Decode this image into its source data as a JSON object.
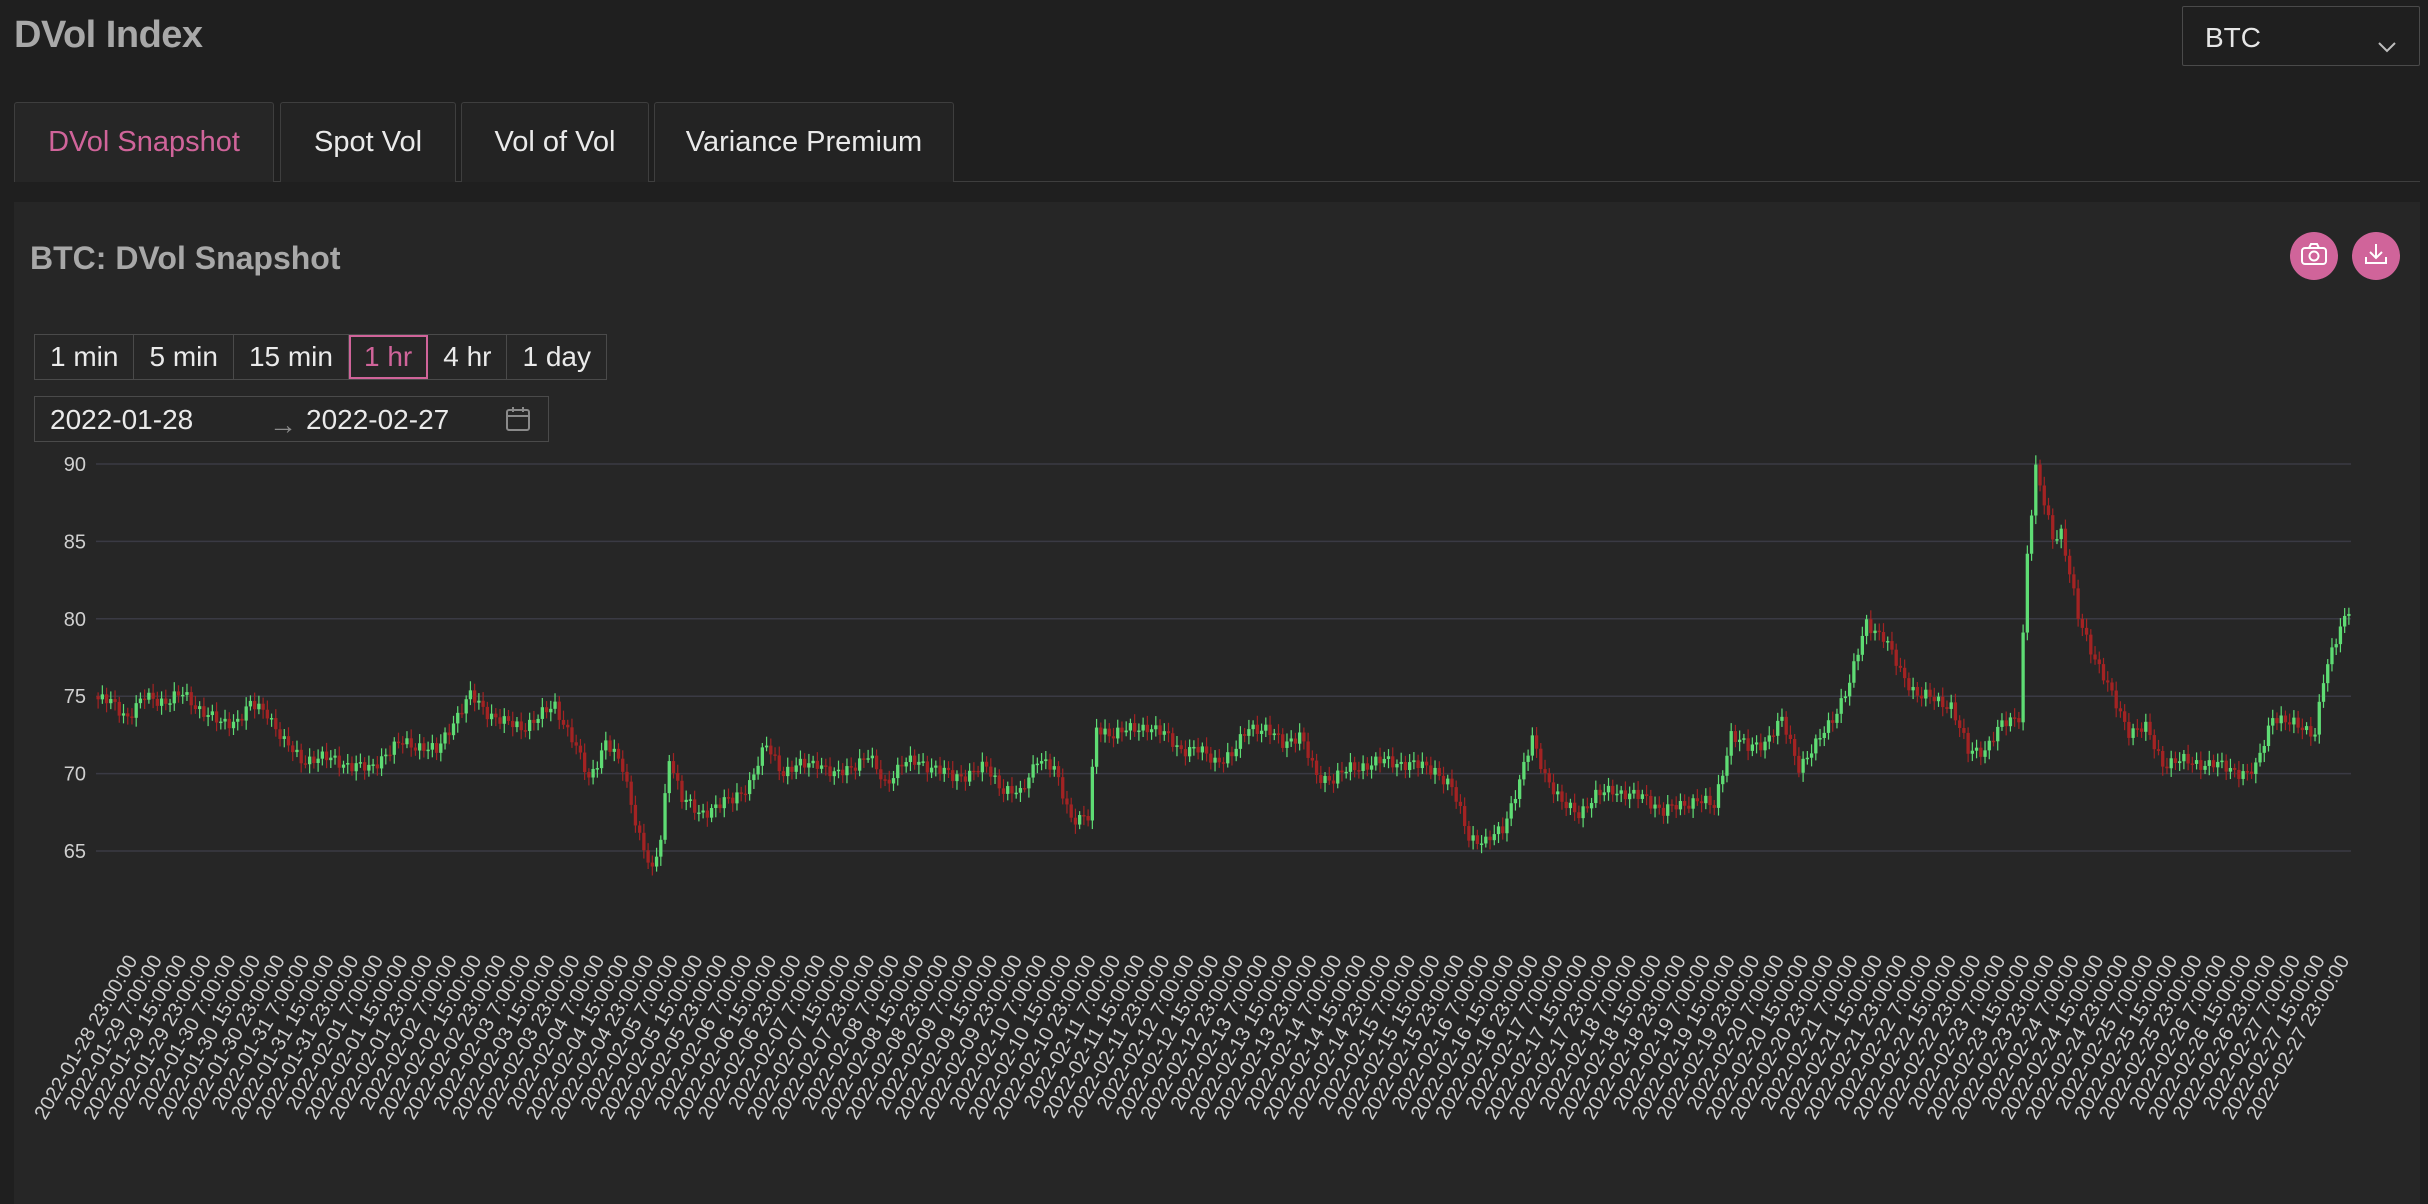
{
  "page": {
    "title": "DVol Index"
  },
  "asset_select": {
    "value": "BTC"
  },
  "tabs": [
    {
      "label": "DVol Snapshot",
      "active": true
    },
    {
      "label": "Spot Vol",
      "active": false
    },
    {
      "label": "Vol of Vol",
      "active": false
    },
    {
      "label": "Variance Premium",
      "active": false
    }
  ],
  "panel": {
    "title": "BTC: DVol Snapshot"
  },
  "icons": {
    "screenshot": "camera-icon",
    "download": "download-icon",
    "calendar": "calendar-icon",
    "dropdown": "chevron-down-icon"
  },
  "colors": {
    "accent": "#d0649a",
    "up": "#5fdc74",
    "down": "#a32323"
  },
  "intervals": [
    {
      "label": "1 min",
      "active": false
    },
    {
      "label": "5 min",
      "active": false
    },
    {
      "label": "15 min",
      "active": false
    },
    {
      "label": "1 hr",
      "active": true
    },
    {
      "label": "4 hr",
      "active": false
    },
    {
      "label": "1 day",
      "active": false
    }
  ],
  "date_range": {
    "start": "2022-01-28",
    "separator": "→",
    "end": "2022-02-27"
  },
  "chart_data": {
    "type": "candlestick",
    "title": "",
    "xlabel": "",
    "ylabel": "",
    "y_ticks": [
      90,
      85,
      80,
      75,
      70,
      65
    ],
    "ylim": [
      63,
      90
    ],
    "x_tick_labels": [
      "2022-01-28 23:00:00",
      "2022-01-29 7:00:00",
      "2022-01-29 15:00:00",
      "2022-01-29 23:00:00",
      "2022-01-30 7:00:00",
      "2022-01-30 15:00:00",
      "2022-01-30 23:00:00",
      "2022-01-31 7:00:00",
      "2022-01-31 15:00:00",
      "2022-01-31 23:00:00",
      "2022-02-01 7:00:00",
      "2022-02-01 15:00:00",
      "2022-02-01 23:00:00",
      "2022-02-02 7:00:00",
      "2022-02-02 15:00:00",
      "2022-02-02 23:00:00",
      "2022-02-03 7:00:00",
      "2022-02-03 15:00:00",
      "2022-02-03 23:00:00",
      "2022-02-04 7:00:00",
      "2022-02-04 15:00:00",
      "2022-02-04 23:00:00",
      "2022-02-05 7:00:00",
      "2022-02-05 15:00:00",
      "2022-02-05 23:00:00",
      "2022-02-06 7:00:00",
      "2022-02-06 15:00:00",
      "2022-02-06 23:00:00",
      "2022-02-07 7:00:00",
      "2022-02-07 15:00:00",
      "2022-02-07 23:00:00",
      "2022-02-08 7:00:00",
      "2022-02-08 15:00:00",
      "2022-02-08 23:00:00",
      "2022-02-09 7:00:00",
      "2022-02-09 15:00:00",
      "2022-02-09 23:00:00",
      "2022-02-10 7:00:00",
      "2022-02-10 15:00:00",
      "2022-02-10 23:00:00",
      "2022-02-11 7:00:00",
      "2022-02-11 15:00:00",
      "2022-02-11 23:00:00",
      "2022-02-12 7:00:00",
      "2022-02-12 15:00:00",
      "2022-02-12 23:00:00",
      "2022-02-13 7:00:00",
      "2022-02-13 15:00:00",
      "2022-02-13 23:00:00",
      "2022-02-14 7:00:00",
      "2022-02-14 15:00:00",
      "2022-02-14 23:00:00",
      "2022-02-15 7:00:00",
      "2022-02-15 15:00:00",
      "2022-02-15 23:00:00",
      "2022-02-16 7:00:00",
      "2022-02-16 15:00:00",
      "2022-02-16 23:00:00",
      "2022-02-17 7:00:00",
      "2022-02-17 15:00:00",
      "2022-02-17 23:00:00",
      "2022-02-18 7:00:00",
      "2022-02-18 15:00:00",
      "2022-02-18 23:00:00",
      "2022-02-19 7:00:00",
      "2022-02-19 15:00:00",
      "2022-02-19 23:00:00",
      "2022-02-20 7:00:00",
      "2022-02-20 15:00:00",
      "2022-02-20 23:00:00",
      "2022-02-21 7:00:00",
      "2022-02-21 15:00:00",
      "2022-02-21 23:00:00",
      "2022-02-22 7:00:00",
      "2022-02-22 15:00:00",
      "2022-02-22 23:00:00",
      "2022-02-23 7:00:00",
      "2022-02-23 15:00:00",
      "2022-02-23 23:00:00",
      "2022-02-24 7:00:00",
      "2022-02-24 15:00:00",
      "2022-02-24 23:00:00",
      "2022-02-25 7:00:00",
      "2022-02-25 15:00:00",
      "2022-02-25 23:00:00",
      "2022-02-26 7:00:00",
      "2022-02-26 15:00:00",
      "2022-02-26 23:00:00",
      "2022-02-27 7:00:00",
      "2022-02-27 15:00:00",
      "2022-02-27 23:00:00"
    ],
    "close_path": [
      [
        0,
        74.8
      ],
      [
        3,
        74.6
      ],
      [
        7,
        73.7
      ],
      [
        11,
        74.9
      ],
      [
        16,
        74.7
      ],
      [
        20,
        75.1
      ],
      [
        25,
        74.0
      ],
      [
        29,
        73.2
      ],
      [
        33,
        73.5
      ],
      [
        36,
        74.4
      ],
      [
        40,
        74.0
      ],
      [
        44,
        72.0
      ],
      [
        48,
        70.9
      ],
      [
        52,
        71.0
      ],
      [
        56,
        70.9
      ],
      [
        60,
        70.5
      ],
      [
        64,
        70.3
      ],
      [
        68,
        71.3
      ],
      [
        72,
        72.0
      ],
      [
        76,
        71.8
      ],
      [
        80,
        71.4
      ],
      [
        84,
        73.4
      ],
      [
        88,
        75.0
      ],
      [
        92,
        74.0
      ],
      [
        96,
        73.3
      ],
      [
        100,
        73.0
      ],
      [
        104,
        73.6
      ],
      [
        108,
        74.4
      ],
      [
        112,
        72.3
      ],
      [
        116,
        69.6
      ],
      [
        120,
        72.1
      ],
      [
        124,
        70.3
      ],
      [
        128,
        66.0
      ],
      [
        131,
        63.5
      ],
      [
        133,
        65.8
      ],
      [
        135,
        71.2
      ],
      [
        138,
        68.4
      ],
      [
        142,
        67.4
      ],
      [
        146,
        67.9
      ],
      [
        150,
        68.3
      ],
      [
        154,
        69.4
      ],
      [
        158,
        71.8
      ],
      [
        162,
        70.1
      ],
      [
        166,
        70.5
      ],
      [
        170,
        70.8
      ],
      [
        174,
        69.8
      ],
      [
        178,
        70.5
      ],
      [
        182,
        71.1
      ],
      [
        186,
        69.4
      ],
      [
        190,
        70.6
      ],
      [
        194,
        70.8
      ],
      [
        198,
        70.3
      ],
      [
        202,
        69.8
      ],
      [
        206,
        70.0
      ],
      [
        210,
        70.4
      ],
      [
        214,
        69.0
      ],
      [
        218,
        68.6
      ],
      [
        222,
        71.1
      ],
      [
        226,
        70.2
      ],
      [
        230,
        67.2
      ],
      [
        234,
        67.1
      ],
      [
        236,
        72.9
      ],
      [
        240,
        72.6
      ],
      [
        244,
        72.8
      ],
      [
        248,
        73.1
      ],
      [
        252,
        72.5
      ],
      [
        256,
        71.6
      ],
      [
        260,
        71.5
      ],
      [
        264,
        70.9
      ],
      [
        268,
        71.1
      ],
      [
        272,
        73.1
      ],
      [
        276,
        72.8
      ],
      [
        280,
        72.0
      ],
      [
        284,
        72.5
      ],
      [
        288,
        69.8
      ],
      [
        292,
        69.7
      ],
      [
        296,
        70.3
      ],
      [
        300,
        70.6
      ],
      [
        304,
        70.8
      ],
      [
        308,
        70.7
      ],
      [
        312,
        70.5
      ],
      [
        316,
        70.3
      ],
      [
        320,
        69.0
      ],
      [
        324,
        66.0
      ],
      [
        328,
        65.5
      ],
      [
        332,
        66.5
      ],
      [
        336,
        69.5
      ],
      [
        339,
        72.2
      ],
      [
        342,
        70.0
      ],
      [
        346,
        68.0
      ],
      [
        350,
        67.5
      ],
      [
        354,
        68.5
      ],
      [
        358,
        69.0
      ],
      [
        362,
        68.6
      ],
      [
        366,
        68.4
      ],
      [
        370,
        67.6
      ],
      [
        374,
        67.9
      ],
      [
        378,
        68.4
      ],
      [
        382,
        67.8
      ],
      [
        386,
        72.6
      ],
      [
        390,
        71.6
      ],
      [
        394,
        72.1
      ],
      [
        398,
        73.4
      ],
      [
        402,
        70.5
      ],
      [
        406,
        71.8
      ],
      [
        410,
        73.6
      ],
      [
        414,
        75.8
      ],
      [
        418,
        79.8
      ],
      [
        422,
        78.8
      ],
      [
        426,
        76.6
      ],
      [
        430,
        75.1
      ],
      [
        434,
        74.8
      ],
      [
        438,
        74.4
      ],
      [
        442,
        71.4
      ],
      [
        446,
        71.6
      ],
      [
        450,
        73.1
      ],
      [
        454,
        73.8
      ],
      [
        456,
        84.2
      ],
      [
        458,
        89.5
      ],
      [
        460,
        87.5
      ],
      [
        462,
        85.4
      ],
      [
        464,
        85.6
      ],
      [
        468,
        80.1
      ],
      [
        472,
        77.5
      ],
      [
        476,
        75.0
      ],
      [
        480,
        72.8
      ],
      [
        484,
        72.9
      ],
      [
        488,
        70.7
      ],
      [
        492,
        70.8
      ],
      [
        496,
        70.7
      ],
      [
        500,
        70.6
      ],
      [
        504,
        70.3
      ],
      [
        508,
        70.0
      ],
      [
        510,
        70.3
      ],
      [
        514,
        73.8
      ],
      [
        518,
        73.2
      ],
      [
        522,
        72.9
      ],
      [
        524,
        72.7
      ],
      [
        526,
        76.0
      ],
      [
        530,
        79.5
      ],
      [
        532,
        80.8
      ]
    ]
  }
}
